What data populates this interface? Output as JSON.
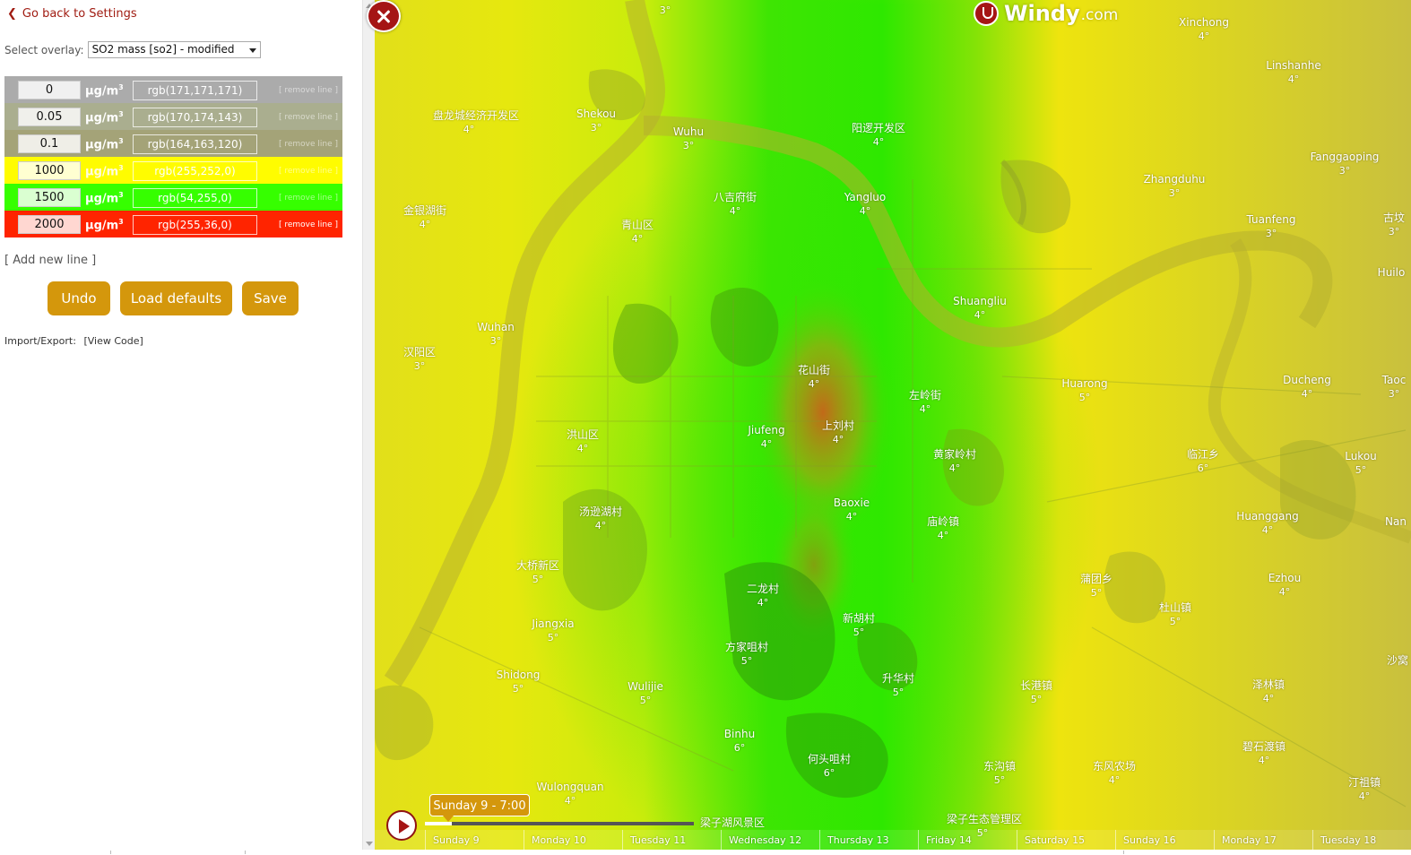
{
  "panel": {
    "back_label": "Go back to Settings",
    "overlay_label": "Select overlay:",
    "overlay_value": "SO2 mass [so2] - modified",
    "legend_rows": [
      {
        "value": "0",
        "unit": "μg/m",
        "unit_sup": "3",
        "color_label": "rgb(171,171,171)",
        "color": "#ababab",
        "remove": "[ remove line ]"
      },
      {
        "value": "0.05",
        "unit": "μg/m",
        "unit_sup": "3",
        "color_label": "rgb(170,174,143)",
        "color": "#aaae8f",
        "remove": "[ remove line ]"
      },
      {
        "value": "0.1",
        "unit": "μg/m",
        "unit_sup": "3",
        "color_label": "rgb(164,163,120)",
        "color": "#a4a378",
        "remove": "[ remove line ]"
      },
      {
        "value": "1000",
        "unit": "μg/m",
        "unit_sup": "3",
        "color_label": "rgb(255,252,0)",
        "color": "#fffc00",
        "remove": "[ remove line ]"
      },
      {
        "value": "1500",
        "unit": "μg/m",
        "unit_sup": "3",
        "color_label": "rgb(54,255,0)",
        "color": "#36ff00",
        "remove": "[ remove line ]"
      },
      {
        "value": "2000",
        "unit": "μg/m",
        "unit_sup": "3",
        "color_label": "rgb(255,36,0)",
        "color": "#ff2400",
        "remove": "[ remove line ]"
      }
    ],
    "add_line": "[ Add new line ]",
    "buttons": {
      "undo": "Undo",
      "load_defaults": "Load defaults",
      "save": "Save"
    },
    "import_export_label": "Import/Export:",
    "view_code": "[View Code]"
  },
  "map": {
    "brand": {
      "name": "Windy",
      "suffix": ".com"
    },
    "time_label": "Sunday 9 - 7:00",
    "days": [
      "Sunday 9",
      "Monday 10",
      "Tuesday 11",
      "Wednesday 12",
      "Thursday 13",
      "Friday 14",
      "Saturday 15",
      "Sunday 16",
      "Monday 17",
      "Tuesday 18"
    ],
    "labels": [
      {
        "name": "",
        "temp": "3°"
      },
      {
        "name": "Xinchong",
        "temp": "4°"
      },
      {
        "name": "Linshanhe",
        "temp": "4°"
      },
      {
        "name": "盘龙城经济开发区",
        "temp": "4°"
      },
      {
        "name": "Shekou",
        "temp": "3°"
      },
      {
        "name": "Wuhu",
        "temp": "3°"
      },
      {
        "name": "阳逻开发区",
        "temp": "4°"
      },
      {
        "name": "Fanggaoping",
        "temp": "3°"
      },
      {
        "name": "Zhangduhu",
        "temp": "3°"
      },
      {
        "name": "八吉府街",
        "temp": "4°"
      },
      {
        "name": "Yangluo",
        "temp": "4°"
      },
      {
        "name": "金银湖街",
        "temp": "4°"
      },
      {
        "name": "青山区",
        "temp": "4°"
      },
      {
        "name": "Tuanfeng",
        "temp": "3°"
      },
      {
        "name": "古坟",
        "temp": "3°"
      },
      {
        "name": "Huilo",
        "temp": ""
      },
      {
        "name": "Shuangliu",
        "temp": "4°"
      },
      {
        "name": "Wuhan",
        "temp": "3°"
      },
      {
        "name": "汉阳区",
        "temp": "3°"
      },
      {
        "name": "花山街",
        "temp": "4°"
      },
      {
        "name": "左岭街",
        "temp": "4°"
      },
      {
        "name": "Huarong",
        "temp": "5°"
      },
      {
        "name": "Ducheng",
        "temp": "4°"
      },
      {
        "name": "Taoc",
        "temp": "3°"
      },
      {
        "name": "洪山区",
        "temp": "4°"
      },
      {
        "name": "Jiufeng",
        "temp": "4°"
      },
      {
        "name": "上刘村",
        "temp": "4°"
      },
      {
        "name": "黄家岭村",
        "temp": "4°"
      },
      {
        "name": "临江乡",
        "temp": "6°"
      },
      {
        "name": "Lukou",
        "temp": "5°"
      },
      {
        "name": "汤逊湖村",
        "temp": "4°"
      },
      {
        "name": "Baoxie",
        "temp": "4°"
      },
      {
        "name": "庙岭镇",
        "temp": "4°"
      },
      {
        "name": "Huanggang",
        "temp": "4°"
      },
      {
        "name": "Nan",
        "temp": ""
      },
      {
        "name": "大桥新区",
        "temp": "5°"
      },
      {
        "name": "二龙村",
        "temp": "4°"
      },
      {
        "name": "蒲团乡",
        "temp": "5°"
      },
      {
        "name": "Ezhou",
        "temp": "4°"
      },
      {
        "name": "杜山镇",
        "temp": "5°"
      },
      {
        "name": "Jiangxia",
        "temp": "5°"
      },
      {
        "name": "新胡村",
        "temp": "5°"
      },
      {
        "name": "方家咀村",
        "temp": "5°"
      },
      {
        "name": "Shidong",
        "temp": "5°"
      },
      {
        "name": "Wulijie",
        "temp": "5°"
      },
      {
        "name": "升华村",
        "temp": "5°"
      },
      {
        "name": "长港镇",
        "temp": "5°"
      },
      {
        "name": "泽林镇",
        "temp": "4°"
      },
      {
        "name": "沙窝",
        "temp": ""
      },
      {
        "name": "Binhu",
        "temp": "6°"
      },
      {
        "name": "何头咀村",
        "temp": "6°"
      },
      {
        "name": "东沟镇",
        "temp": "5°"
      },
      {
        "name": "东风农场",
        "temp": "4°"
      },
      {
        "name": "碧石渡镇",
        "temp": "4°"
      },
      {
        "name": "汀祖镇",
        "temp": "4°"
      },
      {
        "name": "Wulongquan",
        "temp": "4°"
      },
      {
        "name": "梁子湖风景区",
        "temp": ""
      },
      {
        "name": "梁子生态管理区",
        "temp": "5°"
      }
    ]
  }
}
